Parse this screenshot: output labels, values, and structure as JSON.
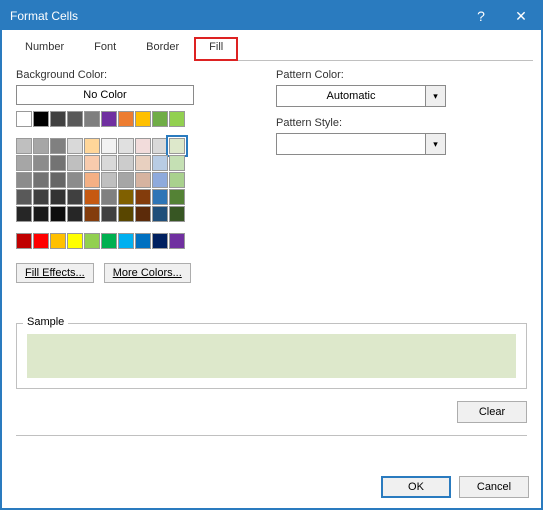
{
  "dialog": {
    "title": "Format Cells",
    "help": "?",
    "close": "✕"
  },
  "tabs": {
    "number": "Number",
    "font": "Font",
    "border": "Border",
    "fill": "Fill"
  },
  "labels": {
    "bgcolor": "Background Color:",
    "nocolor": "No Color",
    "patterncolor": "Pattern Color:",
    "patternstyle": "Pattern Style:",
    "automatic": "Automatic",
    "filleffects": "Fill Effects...",
    "morecolors": "More Colors...",
    "sample": "Sample",
    "clear": "Clear",
    "ok": "OK",
    "cancel": "Cancel"
  },
  "palette": {
    "top_row": [
      "#ffffff",
      "#000000",
      "#404040",
      "#595959",
      "#7f7f7f",
      "#7030a0",
      "#ed7d31",
      "#ffc000",
      "#70ad47",
      "#92d050"
    ],
    "grid": [
      [
        "#bfbfbf",
        "#a6a6a6",
        "#808080",
        "#d9d9d9",
        "#ffd699",
        "#f2f2f2",
        "#e0e0e0",
        "#f2dcdb",
        "#d9d9d9",
        "#dde8cb"
      ],
      [
        "#a6a6a6",
        "#8c8c8c",
        "#737373",
        "#bfbfbf",
        "#f8cbad",
        "#d9d9d9",
        "#cccccc",
        "#e8d0c0",
        "#b8cce4",
        "#c5e0b4"
      ],
      [
        "#8c8c8c",
        "#737373",
        "#666666",
        "#8c8c8c",
        "#f4b084",
        "#bfbfbf",
        "#a6a6a6",
        "#d6b3a0",
        "#8faadc",
        "#a9d18e"
      ],
      [
        "#595959",
        "#404040",
        "#333333",
        "#404040",
        "#c65911",
        "#808080",
        "#806000",
        "#833c0c",
        "#2e75b6",
        "#548235"
      ],
      [
        "#262626",
        "#1a1a1a",
        "#0d0d0d",
        "#262626",
        "#833c0c",
        "#404040",
        "#594600",
        "#5c2b0a",
        "#1f4e79",
        "#375623"
      ]
    ],
    "standard": [
      "#c00000",
      "#ff0000",
      "#ffc000",
      "#ffff00",
      "#92d050",
      "#00b050",
      "#00b0f0",
      "#0070c0",
      "#002060",
      "#7030a0"
    ],
    "selected_row": 0,
    "selected_col": 9
  },
  "preview_color": "#dde8cb"
}
